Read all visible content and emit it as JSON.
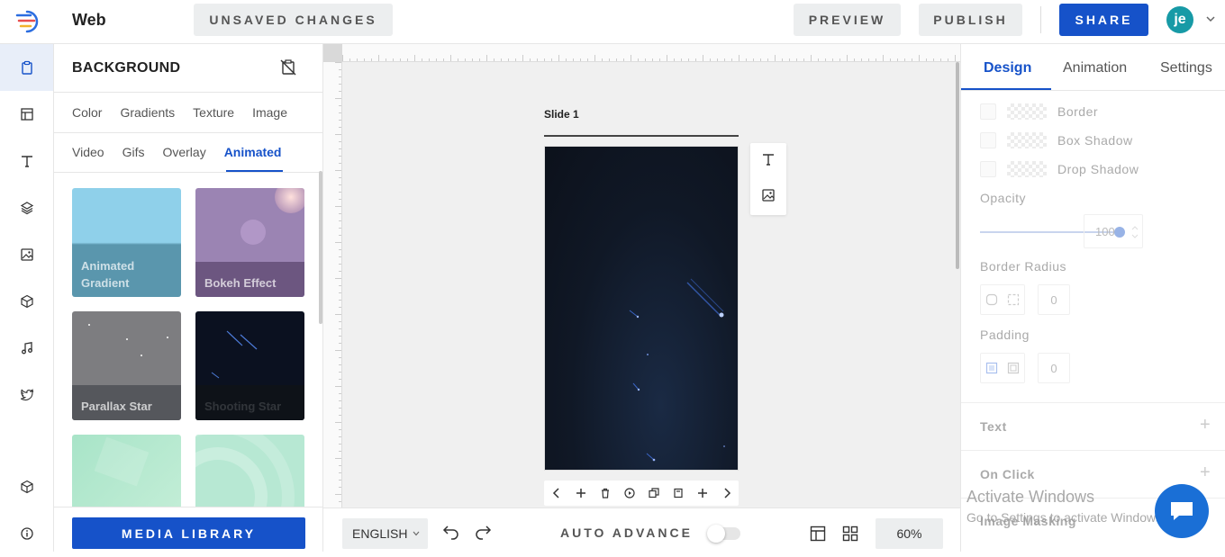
{
  "app": {
    "title": "Web"
  },
  "header": {
    "unsaved_label": "UNSAVED CHANGES",
    "preview_label": "PREVIEW",
    "publish_label": "PUBLISH",
    "share_label": "SHARE",
    "avatar_initials": "je"
  },
  "sidebar": {
    "items": [
      {
        "icon": "clipboard-icon",
        "active": true
      },
      {
        "icon": "layout-icon"
      },
      {
        "icon": "text-icon"
      },
      {
        "icon": "layers-icon"
      },
      {
        "icon": "image-icon"
      },
      {
        "icon": "cube-icon"
      },
      {
        "icon": "music-icon"
      },
      {
        "icon": "twitter-icon"
      },
      {
        "icon": "box-icon"
      },
      {
        "icon": "info-icon"
      }
    ]
  },
  "background_panel": {
    "title": "BACKGROUND",
    "tabs_row1": [
      "Color",
      "Gradients",
      "Texture",
      "Image"
    ],
    "tabs_row2": [
      "Video",
      "Gifs",
      "Overlay",
      "Animated"
    ],
    "active_tab": "Animated",
    "thumbnails": [
      {
        "label": "Animated Gradient"
      },
      {
        "label": "Bokeh  Effect"
      },
      {
        "label": "Parallax  Star"
      },
      {
        "label": "Shooting  Star"
      },
      {
        "label": ""
      },
      {
        "label": ""
      }
    ],
    "media_library_label": "MEDIA LIBRARY"
  },
  "canvas": {
    "slide_label": "Slide  1"
  },
  "bottom_bar": {
    "language": "ENGLISH",
    "auto_advance_label": "AUTO ADVANCE",
    "zoom": "60%"
  },
  "right_panel": {
    "tabs": [
      "Design",
      "Animation",
      "Settings"
    ],
    "active_tab": "Design",
    "border_label": "Border",
    "box_shadow_label": "Box  Shadow",
    "drop_shadow_label": "Drop  Shadow",
    "opacity_label": "Opacity",
    "opacity_value": "100",
    "opacity_fraction": 1.0,
    "border_radius_label": "Border  Radius",
    "border_radius_value": "0",
    "padding_label": "Padding",
    "padding_value": "0",
    "sections": [
      "Text",
      "On  Click",
      "Image  Masking"
    ]
  },
  "overlay": {
    "activate_title": "Activate Windows",
    "activate_sub": "Go to Settings to activate Windows."
  },
  "colors": {
    "accent": "#1652c9",
    "avatar": "#179aa6",
    "chat": "#1a6fd6"
  }
}
